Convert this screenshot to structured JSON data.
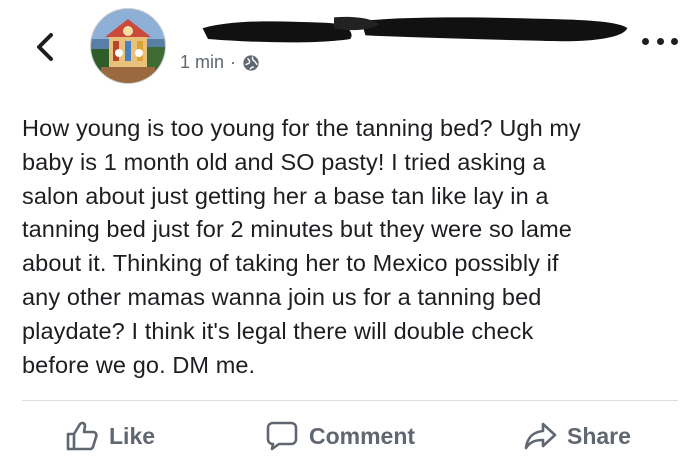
{
  "header": {
    "timestamp": "1 min",
    "separator": "·",
    "privacy_icon": "globe-icon",
    "back_icon": "chevron-left-icon",
    "more_icon": "more-options-icon"
  },
  "post": {
    "lines": [
      "How young is too young for the tanning bed? Ugh my",
      "baby is 1 month old and SO pasty! I tried asking a",
      "salon about just getting her a base tan like lay in a",
      "tanning bed just for 2 minutes but they were so lame",
      "about it. Thinking of taking her to Mexico possibly if",
      "any other mamas wanna join us for a tanning bed",
      "playdate? I think it's legal there will double check",
      "before we go. DM me."
    ]
  },
  "actions": {
    "like_label": "Like",
    "comment_label": "Comment",
    "share_label": "Share"
  },
  "colors": {
    "text": "#1c1e21",
    "muted": "#606770",
    "divider": "#dadde1"
  }
}
